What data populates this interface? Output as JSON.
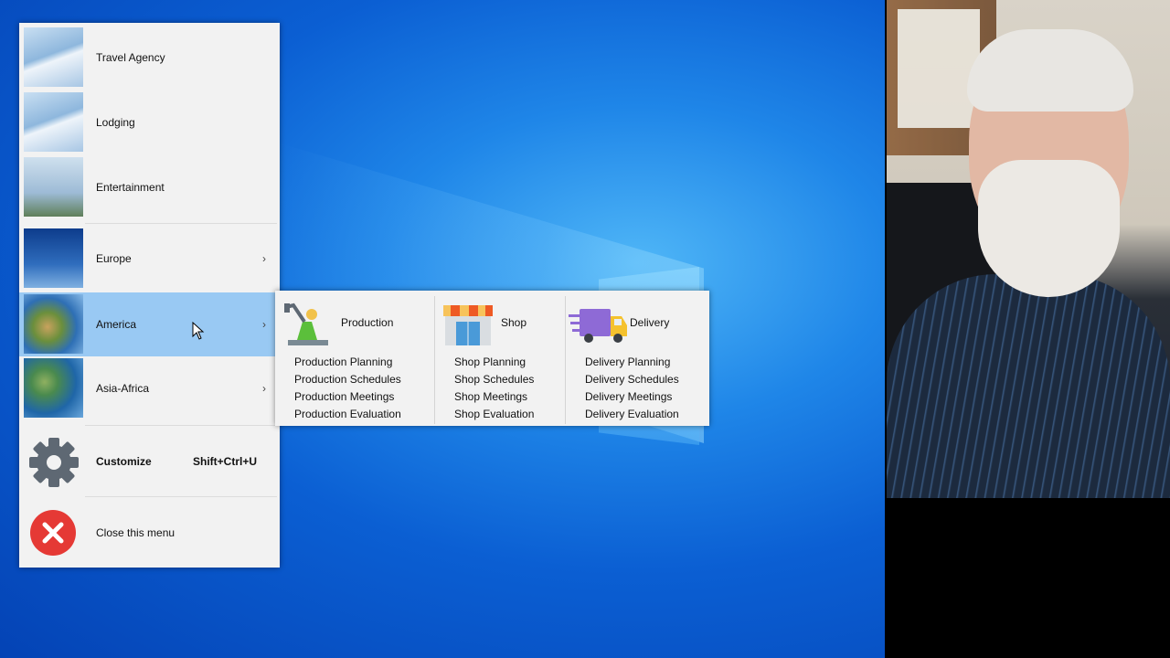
{
  "menu": {
    "items": [
      {
        "label": "Travel Agency"
      },
      {
        "label": "Lodging"
      },
      {
        "label": "Entertainment"
      },
      {
        "label": "Europe",
        "submenu_arrow": "›"
      },
      {
        "label": "America",
        "submenu_arrow": "›"
      },
      {
        "label": "Asia-Africa",
        "submenu_arrow": "›"
      }
    ],
    "customize": {
      "label": "Customize",
      "shortcut": "Shift+Ctrl+U"
    },
    "close": {
      "label": "Close this menu"
    }
  },
  "submenu": {
    "columns": [
      {
        "title": "Production",
        "icon": "production-icon",
        "entries": [
          "Production Planning",
          "Production Schedules",
          "Production Meetings",
          "Production Evaluation"
        ]
      },
      {
        "title": "Shop",
        "icon": "shop-icon",
        "entries": [
          "Shop Planning",
          "Shop Schedules",
          "Shop Meetings",
          "Shop Evaluation"
        ]
      },
      {
        "title": "Delivery",
        "icon": "delivery-truck-icon",
        "entries": [
          "Delivery Planning",
          "Delivery Schedules",
          "Delivery Meetings",
          "Delivery Evaluation"
        ]
      }
    ]
  },
  "colors": {
    "highlight": "#99c9f3",
    "menu_bg": "#f2f2f2",
    "close_red": "#e53935",
    "gear_gray": "#5e6873"
  }
}
